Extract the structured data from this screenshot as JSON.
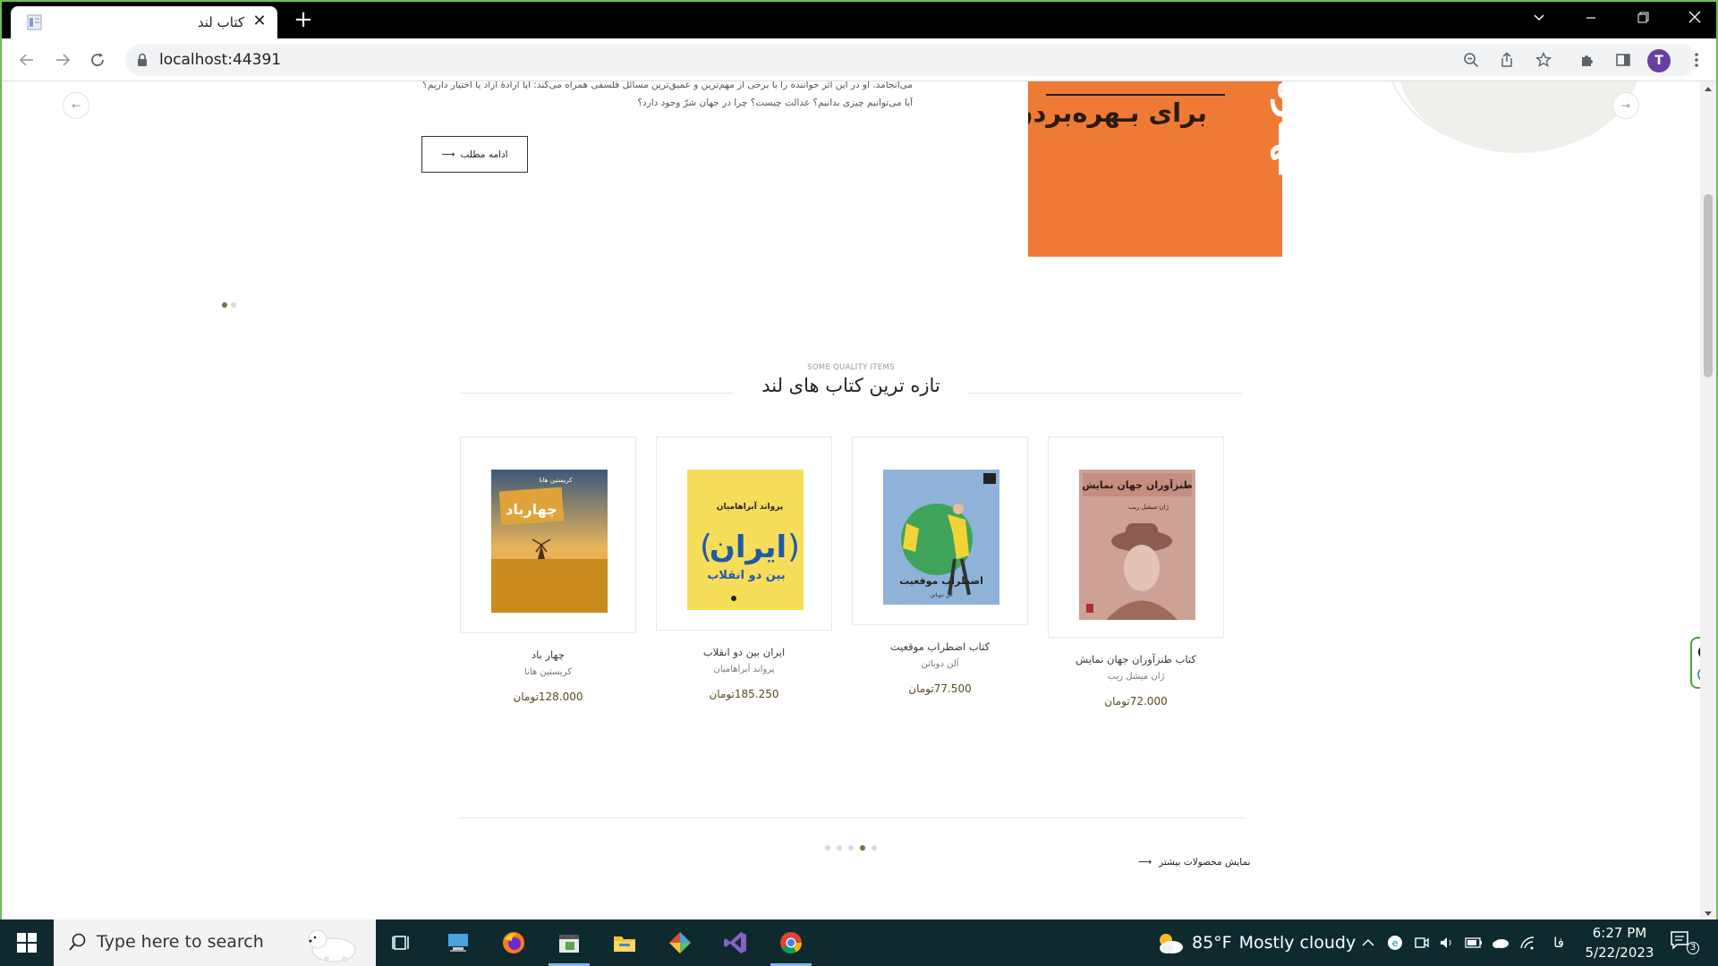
{
  "browser": {
    "tab_title": "کتاب لند",
    "url": "localhost:44391",
    "profile_initial": "T"
  },
  "hero": {
    "paragraph": "می‌انجامد. او در این اثر خواننده را با برخی از مهم‌ترین و عمیق‌ترین مسائل فلسفی همراه می‌کند: آیا ارادهٔ آزاد یا اختیار داریم؟ آیا می‌توانیم چیزی بدانیم؟ عدالت چیست؟ چرا در جهان شرّ وجود دارد؟",
    "button_label": "ادامه مطلب",
    "image_caption": "برای بـهره‌بردن در",
    "image_vertical_text": "ـهـاره",
    "slides_count": 2,
    "active_slide": 0
  },
  "section": {
    "subtitle": "SOME QUALITY ITEMS",
    "title": "تازه ترین کتاب های لند"
  },
  "products": [
    {
      "title": "کتاب طنزآوران جهان نمایش",
      "author": "ژان میشل ریب",
      "price": "72.000تومان",
      "cover_title": "طنزآوران جهان نمایش",
      "cover_subtitle": "ژان-میشل ریب",
      "cover_color": "#c99a8e"
    },
    {
      "title": "کتاب اضطراب موقعیت",
      "author": "آلن دوباتن",
      "price": "77.500تومان",
      "cover_title": "اضطراب موقعیت",
      "cover_subtitle": "آلن دوباتن",
      "cover_color": "#8fb3d8"
    },
    {
      "title": "ایران بین دو انقلاب",
      "author": "پرواند آبراهامیان",
      "price": "185.250تومان",
      "cover_title": "ایران",
      "cover_subtitle": "بین دو انقلاب",
      "cover_author": "پرواند آبراهامیان",
      "cover_color": "#f6dd5a"
    },
    {
      "title": "چهار باد",
      "author": "کریستین هانا",
      "price": "128.000تومان",
      "cover_title": "چهارباد",
      "cover_author": "کریستین هانا",
      "cover_color": "#d9a030"
    }
  ],
  "products_pagination": {
    "count": 5,
    "active": 3
  },
  "more_link": "نمایش محصولات بیشتر",
  "taskbar": {
    "search_placeholder": "Type here to search",
    "weather_temp": "85°F",
    "weather_text": "Mostly cloudy",
    "lang": "فا",
    "time": "6:27 PM",
    "date": "5/22/2023",
    "notification_count": "3"
  }
}
